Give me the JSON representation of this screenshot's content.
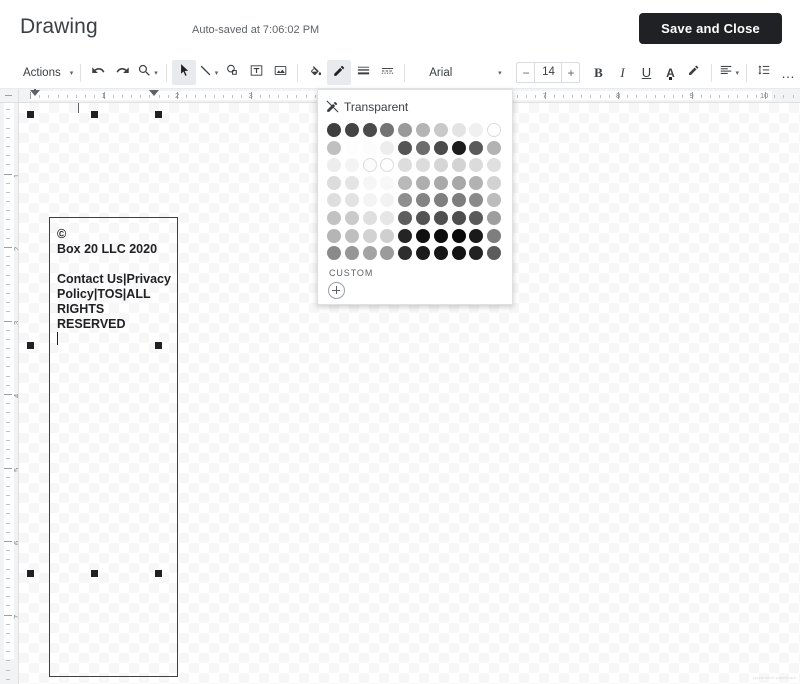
{
  "header": {
    "title": "Drawing",
    "autosave_status": "Auto-saved at 7:06:02 PM",
    "save_button": "Save and Close"
  },
  "toolbar": {
    "actions_label": "Actions",
    "actions_caret": "▾",
    "undo_icon": "undo-icon",
    "redo_icon": "redo-icon",
    "zoom_icon": "zoom-icon",
    "zoom_caret": "▾",
    "select_icon": "select-cursor-icon",
    "line_icon": "line-icon",
    "line_caret": "▾",
    "shape_icon": "shape-icon",
    "textbox_icon": "text-box-icon",
    "image_icon": "image-icon",
    "fill_icon": "fill-color-icon",
    "linecolor_icon": "line-color-icon",
    "lineweight_icon": "line-weight-icon",
    "linedash_icon": "line-dash-icon",
    "font_name": "Arial",
    "font_caret": "▾",
    "size_decrease": "−",
    "font_size": "14",
    "size_increase": "+",
    "bold_label": "B",
    "italic_label": "I",
    "underline_label": "U",
    "textcolor_label": "A",
    "highlight_icon": "highlight-pen-icon",
    "align_icon": "align-icon",
    "align_caret": "▾",
    "linespacing_icon": "line-spacing-icon",
    "more_label": "…"
  },
  "rulers": {
    "horizontal_numbers": [
      "1",
      "2",
      "3",
      "4",
      "5",
      "6",
      "7",
      "8",
      "9",
      "10"
    ],
    "vertical_numbers": [
      "1",
      "2",
      "3",
      "4",
      "5",
      "6",
      "7"
    ],
    "unit": "inch"
  },
  "canvas": {
    "background": "transparent-checkerboard",
    "shape": {
      "type": "text-box",
      "text": "©\nBox 20 LLC 2020\n\nContact Us|Privacy Policy|TOS|ALL RIGHTS RESERVED\n",
      "selected": true,
      "handle_count": 8
    },
    "watermark": "screenshot watermark"
  },
  "color_picker": {
    "open": true,
    "transparent_label": "Transparent",
    "transparent_icon": "no-fill-icon",
    "custom_label": "CUSTOM",
    "custom_add_icon": "plus-circle-icon",
    "columns": 10,
    "rows": [
      [
        "#3f3f3f",
        "#444444",
        "#4a4a4a",
        "#737373",
        "#9a9a9a",
        "#b4b4b4",
        "#c9c9c9",
        "#e3e3e3",
        "#f0f0f0",
        "#ffffff"
      ],
      [
        "#c0c0c0",
        "#fdfdfd",
        "#fcfcfc",
        "#ededed",
        "#555555",
        "#6d6d6d",
        "#4b4b4b",
        "#1c1c1c",
        "#5a5a5a",
        "#b3b3b3"
      ],
      [
        "#ededed",
        "#f3f3f3",
        "#fbfbfb",
        "#ffffff",
        "#dddddd",
        "#dcdcdc",
        "#d6d6d6",
        "#d3d3d3",
        "#dbdbdb",
        "#e0e0e0"
      ],
      [
        "#dcdcdc",
        "#e4e4e4",
        "#f6f6f6",
        "#f8f8f8",
        "#b9b9b9",
        "#aeaeae",
        "#a9a9a9",
        "#a8a8a8",
        "#b2b2b2",
        "#d2d2d2"
      ],
      [
        "#dedede",
        "#e2e2e2",
        "#f4f4f4",
        "#f2f2f2",
        "#8f8f8f",
        "#848484",
        "#7f7f7f",
        "#7d7d7d",
        "#8b8b8b",
        "#bcbcbc"
      ],
      [
        "#c2c2c2",
        "#cacaca",
        "#dfdfdf",
        "#e6e6e6",
        "#5e5e5e",
        "#535353",
        "#4f4f4f",
        "#4d4d4d",
        "#5a5a5a",
        "#9e9e9e"
      ],
      [
        "#b5b5b5",
        "#bfbfbf",
        "#d2d2d2",
        "#cfcfcf",
        "#242424",
        "#101010",
        "#0c0c0c",
        "#0a0a0a",
        "#1a1a1a",
        "#7e7e7e"
      ],
      [
        "#8a8a8a",
        "#969696",
        "#a3a3a3",
        "#9b9b9b",
        "#2e2e2e",
        "#1b1b1b",
        "#161616",
        "#141414",
        "#222222",
        "#5c5c5c"
      ]
    ],
    "outlined_cells": [
      [
        0,
        9
      ],
      [
        2,
        2
      ],
      [
        2,
        3
      ]
    ]
  },
  "colors": {
    "accent_dark": "#202124",
    "toolbar_text": "#3c4043",
    "muted_text": "#5f6368",
    "ruler_bg": "#f1f3f4",
    "active_tool_bg": "#e8eaed"
  }
}
